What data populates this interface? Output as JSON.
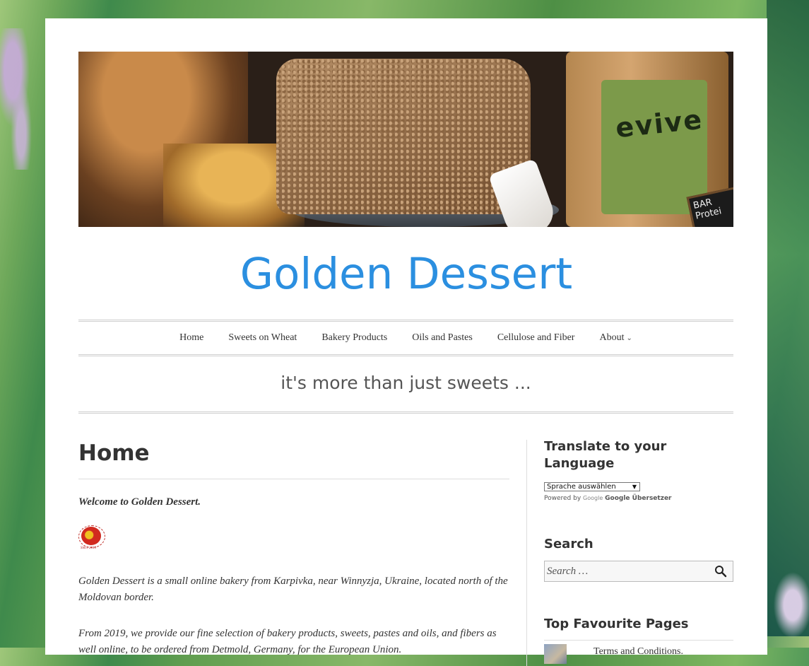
{
  "site": {
    "title": "Golden Dessert",
    "tagline": "it's more than just sweets ...",
    "title_color": "#2b8fe0"
  },
  "banner": {
    "bag_text": "evive",
    "sign_text": "BAR Protei"
  },
  "nav": {
    "items": [
      {
        "label": "Home"
      },
      {
        "label": "Sweets on Wheat"
      },
      {
        "label": "Bakery Products"
      },
      {
        "label": "Oils and Pastes"
      },
      {
        "label": "Cellulose and Fiber"
      },
      {
        "label": "About",
        "has_submenu": true,
        "icon": "chevron-down-icon"
      }
    ]
  },
  "main": {
    "heading": "Home",
    "welcome": "Welcome to Golden Dessert.",
    "paragraphs": [
      "Golden Dessert is a small online bakery from Karpivka, near Winnyzja, Ukraine, located north of the Moldovan border.",
      "From 2019, we provide our fine selection of bakery products, sweets, pastes and oils, and fibers as well online, to be ordered from Detmold, Germany, for the European Union."
    ],
    "logo_caption": "Since 2019"
  },
  "sidebar": {
    "translate": {
      "title": "Translate to your Language",
      "select_value": "Sprache auswählen",
      "powered_prefix": "Powered by",
      "google_logo": "Google",
      "translator_name": "Google Übersetzer"
    },
    "search": {
      "title": "Search",
      "placeholder": "Search …",
      "icon": "search-icon"
    },
    "favourites": {
      "title": "Top Favourite Pages",
      "items": [
        {
          "label": "Terms and Conditions."
        }
      ]
    }
  }
}
